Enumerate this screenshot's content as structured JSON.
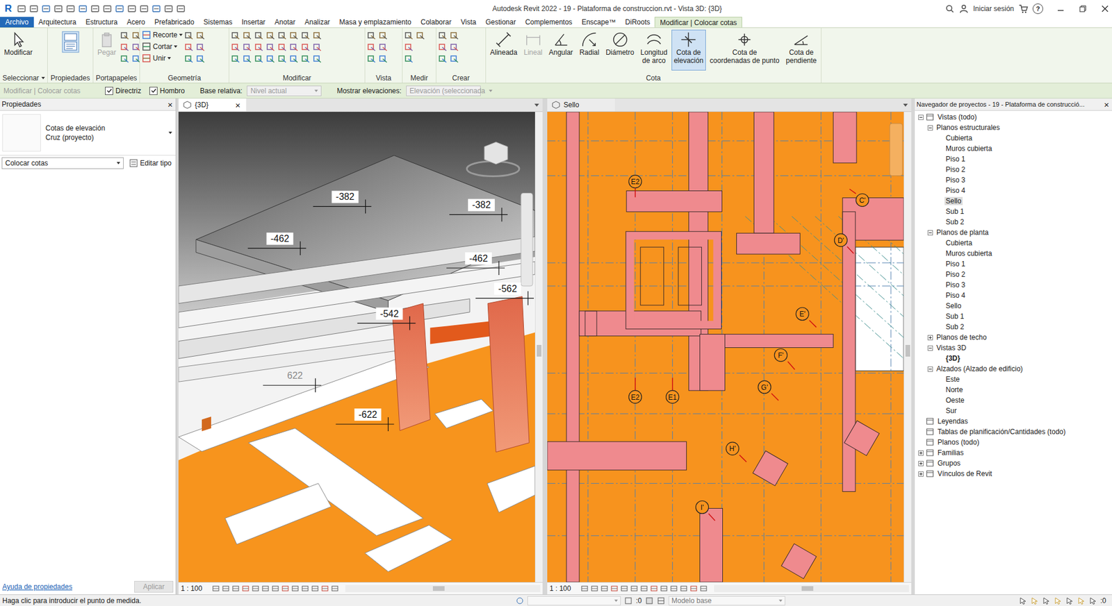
{
  "window": {
    "logo": "R",
    "title": "Autodesk Revit 2022 - 19 - Plataforma de construccion.rvt - Vista 3D: {3D}",
    "sign_in": "Iniciar sesión",
    "help": "?"
  },
  "menu_tabs": [
    {
      "label": "Archivo",
      "kind": "file",
      "selected": false
    },
    {
      "label": "Arquitectura",
      "kind": "tab",
      "selected": false
    },
    {
      "label": "Estructura",
      "kind": "tab",
      "selected": false
    },
    {
      "label": "Acero",
      "kind": "tab",
      "selected": false
    },
    {
      "label": "Prefabricado",
      "kind": "tab",
      "selected": false
    },
    {
      "label": "Sistemas",
      "kind": "tab",
      "selected": false
    },
    {
      "label": "Insertar",
      "kind": "tab",
      "selected": false
    },
    {
      "label": "Anotar",
      "kind": "tab",
      "selected": false
    },
    {
      "label": "Analizar",
      "kind": "tab",
      "selected": false
    },
    {
      "label": "Masa y emplazamiento",
      "kind": "tab",
      "selected": false
    },
    {
      "label": "Colaborar",
      "kind": "tab",
      "selected": false
    },
    {
      "label": "Vista",
      "kind": "tab",
      "selected": false
    },
    {
      "label": "Gestionar",
      "kind": "tab",
      "selected": false
    },
    {
      "label": "Complementos",
      "kind": "tab",
      "selected": false
    },
    {
      "label": "Enscape™",
      "kind": "tab",
      "selected": false
    },
    {
      "label": "DiRoots",
      "kind": "tab",
      "selected": false
    },
    {
      "label": "Modificar | Colocar cotas",
      "kind": "context",
      "selected": true
    }
  ],
  "ribbon": {
    "panels": [
      {
        "title": "Seleccionar",
        "dropdown": true,
        "buttons": [
          {
            "label": "Modificar",
            "kind": "large",
            "disabled": false,
            "selected": false,
            "dropdown": false
          }
        ]
      },
      {
        "title": "Propiedades",
        "dropdown": false,
        "buttons": []
      },
      {
        "title": "Portapapeles",
        "dropdown": false,
        "buttons": [
          {
            "label": "Pegar",
            "kind": "large",
            "disabled": true,
            "selected": false,
            "dropdown": false
          }
        ]
      },
      {
        "title": "Geometría",
        "dropdown": false,
        "buttons": [
          {
            "label": "Recorte",
            "kind": "small",
            "disabled": false,
            "selected": false,
            "dropdown": true
          },
          {
            "label": "Cortar",
            "kind": "small",
            "disabled": false,
            "selected": false,
            "dropdown": true
          },
          {
            "label": "Unir",
            "kind": "small",
            "disabled": false,
            "selected": false,
            "dropdown": true
          }
        ]
      },
      {
        "title": "Modificar",
        "dropdown": false,
        "buttons": []
      },
      {
        "title": "Vista",
        "dropdown": false,
        "buttons": []
      },
      {
        "title": "Medir",
        "dropdown": false,
        "buttons": []
      },
      {
        "title": "Crear",
        "dropdown": false,
        "buttons": []
      },
      {
        "title": "Cota",
        "dropdown": false,
        "buttons": [
          {
            "label": "Alineada",
            "kind": "large",
            "disabled": false,
            "selected": false,
            "dropdown": false
          },
          {
            "label": "Lineal",
            "kind": "large",
            "disabled": true,
            "selected": false,
            "dropdown": false
          },
          {
            "label": "Angular",
            "kind": "large",
            "disabled": false,
            "selected": false,
            "dropdown": false
          },
          {
            "label": "Radial",
            "kind": "large",
            "disabled": false,
            "selected": false,
            "dropdown": false
          },
          {
            "label": "Diámetro",
            "kind": "large",
            "disabled": false,
            "selected": false,
            "dropdown": false
          },
          {
            "label": "Longitud\nde arco",
            "kind": "large",
            "disabled": false,
            "selected": false,
            "dropdown": false
          },
          {
            "label": "Cota de\nelevación",
            "kind": "large",
            "disabled": false,
            "selected": true,
            "dropdown": false
          },
          {
            "label": "Cota de\ncoordenadas de punto",
            "kind": "large",
            "disabled": false,
            "selected": false,
            "dropdown": false
          },
          {
            "label": "Cota de\npendiente",
            "kind": "large",
            "disabled": false,
            "selected": false,
            "dropdown": false
          }
        ]
      }
    ]
  },
  "options_bar": {
    "context": "Modificar | Colocar cotas",
    "checkboxes": [
      {
        "label": "Directriz",
        "checked": true
      },
      {
        "label": "Hombro",
        "checked": true
      }
    ],
    "fields": [
      {
        "label": "Base relativa:",
        "value": "Nivel actual",
        "disabled": true
      },
      {
        "label": "Mostrar elevaciones:",
        "value": "Elevación (seleccionada",
        "disabled": true
      }
    ]
  },
  "properties": {
    "title": "Propiedades",
    "close": "×",
    "type_name": "Cotas de elevación",
    "type_sub": "Cruz (proyecto)",
    "instance": "Colocar cotas",
    "edit_type": "Editar tipo",
    "help": "Ayuda de propiedades",
    "apply": "Aplicar",
    "apply_disabled": true
  },
  "views": [
    {
      "tab": "{3D}",
      "close": "×",
      "active": true,
      "scale": "1 : 100"
    },
    {
      "tab": "Sello",
      "active": false,
      "scale": "1 : 100"
    }
  ],
  "view3d": {
    "tags": [
      {
        "label": "-382",
        "faded": false
      },
      {
        "label": "-382",
        "faded": false
      },
      {
        "label": "-462",
        "faded": false
      },
      {
        "label": "-462",
        "faded": false
      },
      {
        "label": "-562",
        "faded": false
      },
      {
        "label": "-542",
        "faded": false
      },
      {
        "label": "622",
        "faded": true
      },
      {
        "label": "-622",
        "faded": false
      }
    ]
  },
  "plan": {
    "grid_bubbles": [
      {
        "label": "E2"
      },
      {
        "label": "C'"
      },
      {
        "label": "D'"
      },
      {
        "label": "E'"
      },
      {
        "label": "F'"
      },
      {
        "label": "G'"
      },
      {
        "label": "E2"
      },
      {
        "label": "E1"
      },
      {
        "label": "H'"
      },
      {
        "label": "I'"
      }
    ]
  },
  "project_browser": {
    "title": "Navegador de proyectos - 19 - Plataforma de construcció...",
    "close": "×",
    "items": [
      {
        "label": "Vistas (todo)",
        "level": 0,
        "expandable": true,
        "expanded": true,
        "selected": false,
        "bold": false
      },
      {
        "label": "Planos estructurales",
        "level": 1,
        "expandable": true,
        "expanded": true,
        "selected": false,
        "bold": false
      },
      {
        "label": "Cubierta",
        "level": 2,
        "expandable": false,
        "expanded": false,
        "selected": false,
        "bold": false
      },
      {
        "label": "Muros cubierta",
        "level": 2,
        "expandable": false,
        "expanded": false,
        "selected": false,
        "bold": false
      },
      {
        "label": "Piso 1",
        "level": 2,
        "expandable": false,
        "expanded": false,
        "selected": false,
        "bold": false
      },
      {
        "label": "Piso 2",
        "level": 2,
        "expandable": false,
        "expanded": false,
        "selected": false,
        "bold": false
      },
      {
        "label": "Piso 3",
        "level": 2,
        "expandable": false,
        "expanded": false,
        "selected": false,
        "bold": false
      },
      {
        "label": "Piso 4",
        "level": 2,
        "expandable": false,
        "expanded": false,
        "selected": false,
        "bold": false
      },
      {
        "label": "Sello",
        "level": 2,
        "expandable": false,
        "expanded": false,
        "selected": true,
        "bold": false
      },
      {
        "label": "Sub 1",
        "level": 2,
        "expandable": false,
        "expanded": false,
        "selected": false,
        "bold": false
      },
      {
        "label": "Sub 2",
        "level": 2,
        "expandable": false,
        "expanded": false,
        "selected": false,
        "bold": false
      },
      {
        "label": "Planos de planta",
        "level": 1,
        "expandable": true,
        "expanded": true,
        "selected": false,
        "bold": false
      },
      {
        "label": "Cubierta",
        "level": 2,
        "expandable": false,
        "expanded": false,
        "selected": false,
        "bold": false
      },
      {
        "label": "Muros cubierta",
        "level": 2,
        "expandable": false,
        "expanded": false,
        "selected": false,
        "bold": false
      },
      {
        "label": "Piso 1",
        "level": 2,
        "expandable": false,
        "expanded": false,
        "selected": false,
        "bold": false
      },
      {
        "label": "Piso 2",
        "level": 2,
        "expandable": false,
        "expanded": false,
        "selected": false,
        "bold": false
      },
      {
        "label": "Piso 3",
        "level": 2,
        "expandable": false,
        "expanded": false,
        "selected": false,
        "bold": false
      },
      {
        "label": "Piso 4",
        "level": 2,
        "expandable": false,
        "expanded": false,
        "selected": false,
        "bold": false
      },
      {
        "label": "Sello",
        "level": 2,
        "expandable": false,
        "expanded": false,
        "selected": false,
        "bold": false
      },
      {
        "label": "Sub 1",
        "level": 2,
        "expandable": false,
        "expanded": false,
        "selected": false,
        "bold": false
      },
      {
        "label": "Sub 2",
        "level": 2,
        "expandable": false,
        "expanded": false,
        "selected": false,
        "bold": false
      },
      {
        "label": "Planos de techo",
        "level": 1,
        "expandable": true,
        "expanded": false,
        "selected": false,
        "bold": false
      },
      {
        "label": "Vistas 3D",
        "level": 1,
        "expandable": true,
        "expanded": true,
        "selected": false,
        "bold": false
      },
      {
        "label": "{3D}",
        "level": 2,
        "expandable": false,
        "expanded": false,
        "selected": false,
        "bold": true
      },
      {
        "label": "Alzados (Alzado de edificio)",
        "level": 1,
        "expandable": true,
        "expanded": true,
        "selected": false,
        "bold": false
      },
      {
        "label": "Este",
        "level": 2,
        "expandable": false,
        "expanded": false,
        "selected": false,
        "bold": false
      },
      {
        "label": "Norte",
        "level": 2,
        "expandable": false,
        "expanded": false,
        "selected": false,
        "bold": false
      },
      {
        "label": "Oeste",
        "level": 2,
        "expandable": false,
        "expanded": false,
        "selected": false,
        "bold": false
      },
      {
        "label": "Sur",
        "level": 2,
        "expandable": false,
        "expanded": false,
        "selected": false,
        "bold": false
      },
      {
        "label": "Leyendas",
        "level": 0,
        "expandable": false,
        "expanded": false,
        "selected": false,
        "bold": false
      },
      {
        "label": "Tablas de planificación/Cantidades (todo)",
        "level": 0,
        "expandable": false,
        "expanded": false,
        "selected": false,
        "bold": false
      },
      {
        "label": "Planos (todo)",
        "level": 0,
        "expandable": false,
        "expanded": false,
        "selected": false,
        "bold": false
      },
      {
        "label": "Familias",
        "level": 0,
        "expandable": true,
        "expanded": false,
        "selected": false,
        "bold": false
      },
      {
        "label": "Grupos",
        "level": 0,
        "expandable": true,
        "expanded": false,
        "selected": false,
        "bold": false
      },
      {
        "label": "Vínculos de Revit",
        "level": 0,
        "expandable": true,
        "expanded": false,
        "selected": false,
        "bold": false
      }
    ]
  },
  "status_bar": {
    "message": "Haga clic para introducir el punto de medida.",
    "workset": ":0",
    "model": "Modelo base",
    "selection": ":0"
  }
}
